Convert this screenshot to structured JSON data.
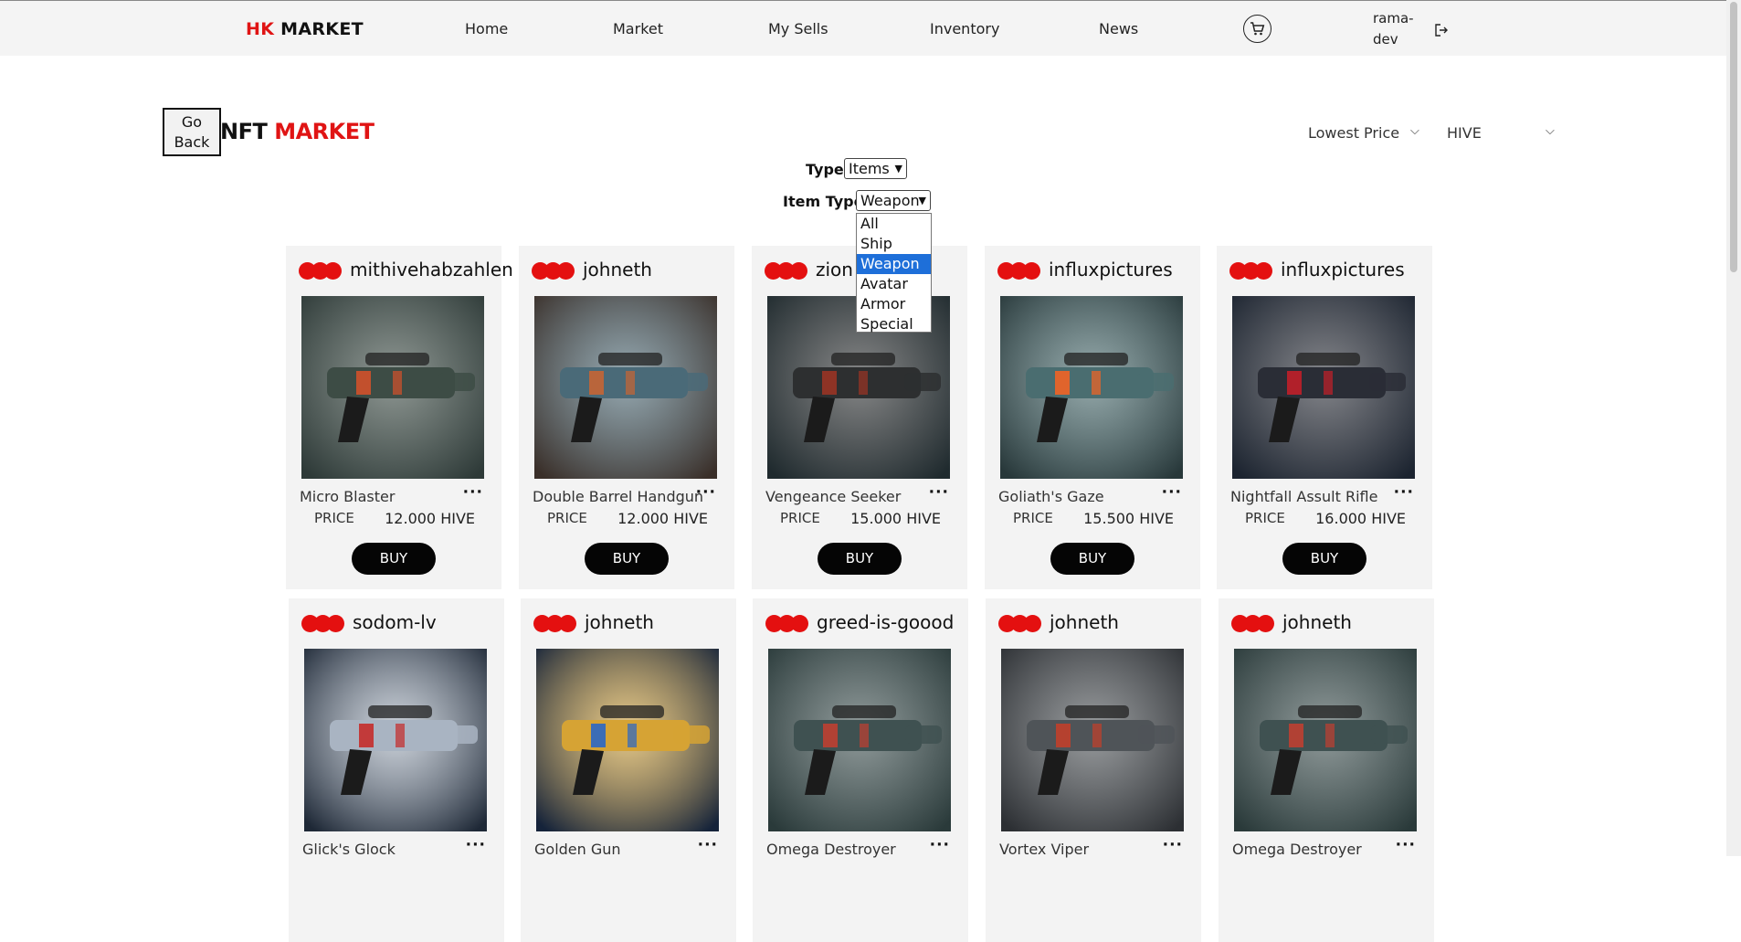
{
  "header": {
    "brand_accent": "HK",
    "brand_rest": " MARKET",
    "nav": [
      "Home",
      "Market",
      "My Sells",
      "Inventory",
      "News"
    ],
    "user": "rama-dev"
  },
  "page": {
    "back_label": "Go Back",
    "title_prefix": "NFT",
    "title_accent": " MARKET",
    "sort_value": "Lowest Price",
    "currency_value": "HIVE"
  },
  "filters": {
    "type_label": "Type",
    "type_value": "Items",
    "item_type_label": "Item Type",
    "item_type_value": "Weapon",
    "item_type_options": [
      "All",
      "Ship",
      "Weapon",
      "Avatar",
      "Armor",
      "Special"
    ],
    "selected_option": "Weapon"
  },
  "price_label": "PRICE",
  "buy_label": "BUY",
  "more_label": "···",
  "cards": [
    {
      "owner": "mithivehabzahlen",
      "name": "Micro Blaster",
      "price": "12.000 HIVE",
      "img": "blaster-green"
    },
    {
      "owner": "johneth",
      "name": "Double Barrel Handgun",
      "price": "12.000 HIVE",
      "img": "handgun-blue"
    },
    {
      "owner": "zion",
      "name": "Vengeance Seeker",
      "price": "15.000 HIVE",
      "img": "rifle-dark"
    },
    {
      "owner": "influxpictures",
      "name": "Goliath's Gaze",
      "price": "15.500 HIVE",
      "img": "cannon-teal"
    },
    {
      "owner": "influxpictures",
      "name": "Nightfall Assult Rifle",
      "price": "16.000 HIVE",
      "img": "rifle-red"
    },
    {
      "owner": "sodom-lv",
      "name": "Glick's Glock",
      "price": "",
      "img": "pistol-silver"
    },
    {
      "owner": "johneth",
      "name": "Golden Gun",
      "price": "",
      "img": "pistol-gold"
    },
    {
      "owner": "greed-is-goood",
      "name": "Omega Destroyer",
      "price": "",
      "img": "blaster-teal"
    },
    {
      "owner": "johneth",
      "name": "Vortex Viper",
      "price": "",
      "img": "blaster-grey"
    },
    {
      "owner": "johneth",
      "name": "Omega Destroyer",
      "price": "",
      "img": "blaster-teal"
    }
  ],
  "colors": {
    "accent": "#e01414",
    "button": "#050505",
    "selection": "#1e6fd9",
    "card_bg": "#f3f3f3"
  }
}
